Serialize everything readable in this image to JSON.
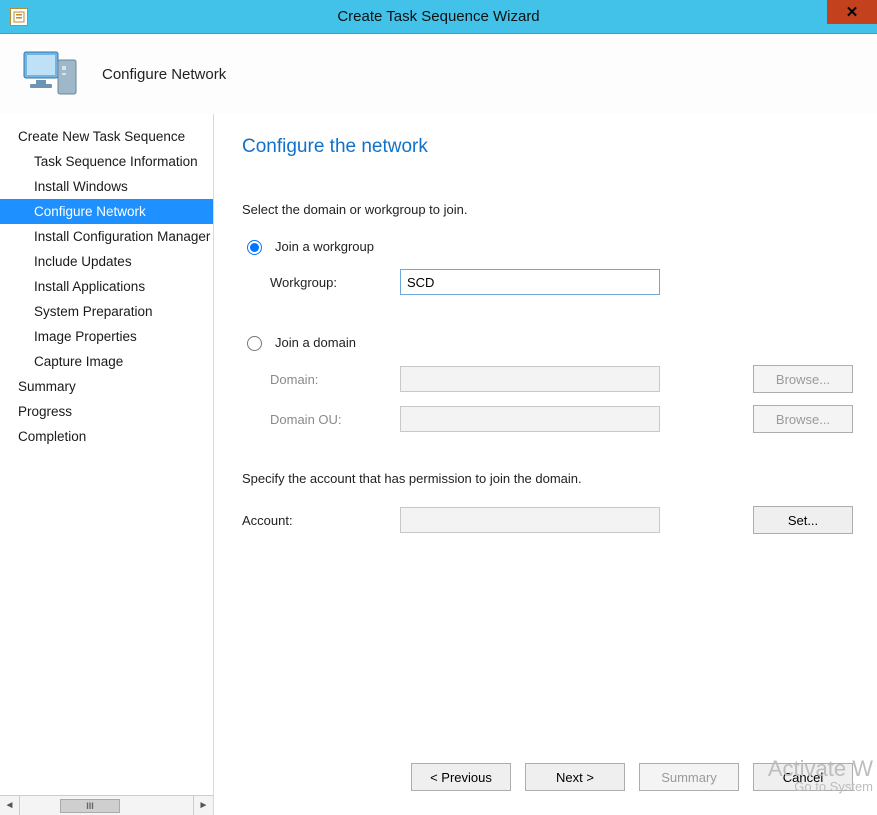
{
  "window": {
    "title": "Create Task Sequence Wizard",
    "close_glyph": "✕"
  },
  "header": {
    "title": "Configure Network"
  },
  "sidebar": {
    "items": [
      {
        "label": "Create New Task Sequence",
        "child": false,
        "selected": false
      },
      {
        "label": "Task Sequence Information",
        "child": true,
        "selected": false
      },
      {
        "label": "Install Windows",
        "child": true,
        "selected": false
      },
      {
        "label": "Configure Network",
        "child": true,
        "selected": true
      },
      {
        "label": "Install Configuration Manager",
        "child": true,
        "selected": false
      },
      {
        "label": "Include Updates",
        "child": true,
        "selected": false
      },
      {
        "label": "Install Applications",
        "child": true,
        "selected": false
      },
      {
        "label": "System Preparation",
        "child": true,
        "selected": false
      },
      {
        "label": "Image Properties",
        "child": true,
        "selected": false
      },
      {
        "label": "Capture Image",
        "child": true,
        "selected": false
      },
      {
        "label": "Summary",
        "child": false,
        "selected": false
      },
      {
        "label": "Progress",
        "child": false,
        "selected": false
      },
      {
        "label": "Completion",
        "child": false,
        "selected": false
      }
    ],
    "scroll_thumb_label": "III"
  },
  "page": {
    "heading": "Configure the network",
    "instruction": "Select the domain or workgroup to join.",
    "workgroup_radio_label": "Join a workgroup",
    "workgroup_field_label": "Workgroup:",
    "workgroup_value": "SCD",
    "domain_radio_label": "Join a domain",
    "domain_field_label": "Domain:",
    "domain_value": "",
    "domain_ou_field_label": "Domain OU:",
    "domain_ou_value": "",
    "browse_label": "Browse...",
    "account_instruction": "Specify the account that has permission to join the domain.",
    "account_field_label": "Account:",
    "account_value": "",
    "set_label": "Set..."
  },
  "footer": {
    "previous": "< Previous",
    "next": "Next >",
    "summary": "Summary",
    "cancel": "Cancel"
  },
  "watermark": {
    "line1": "Activate W",
    "line2": "Go to System"
  }
}
